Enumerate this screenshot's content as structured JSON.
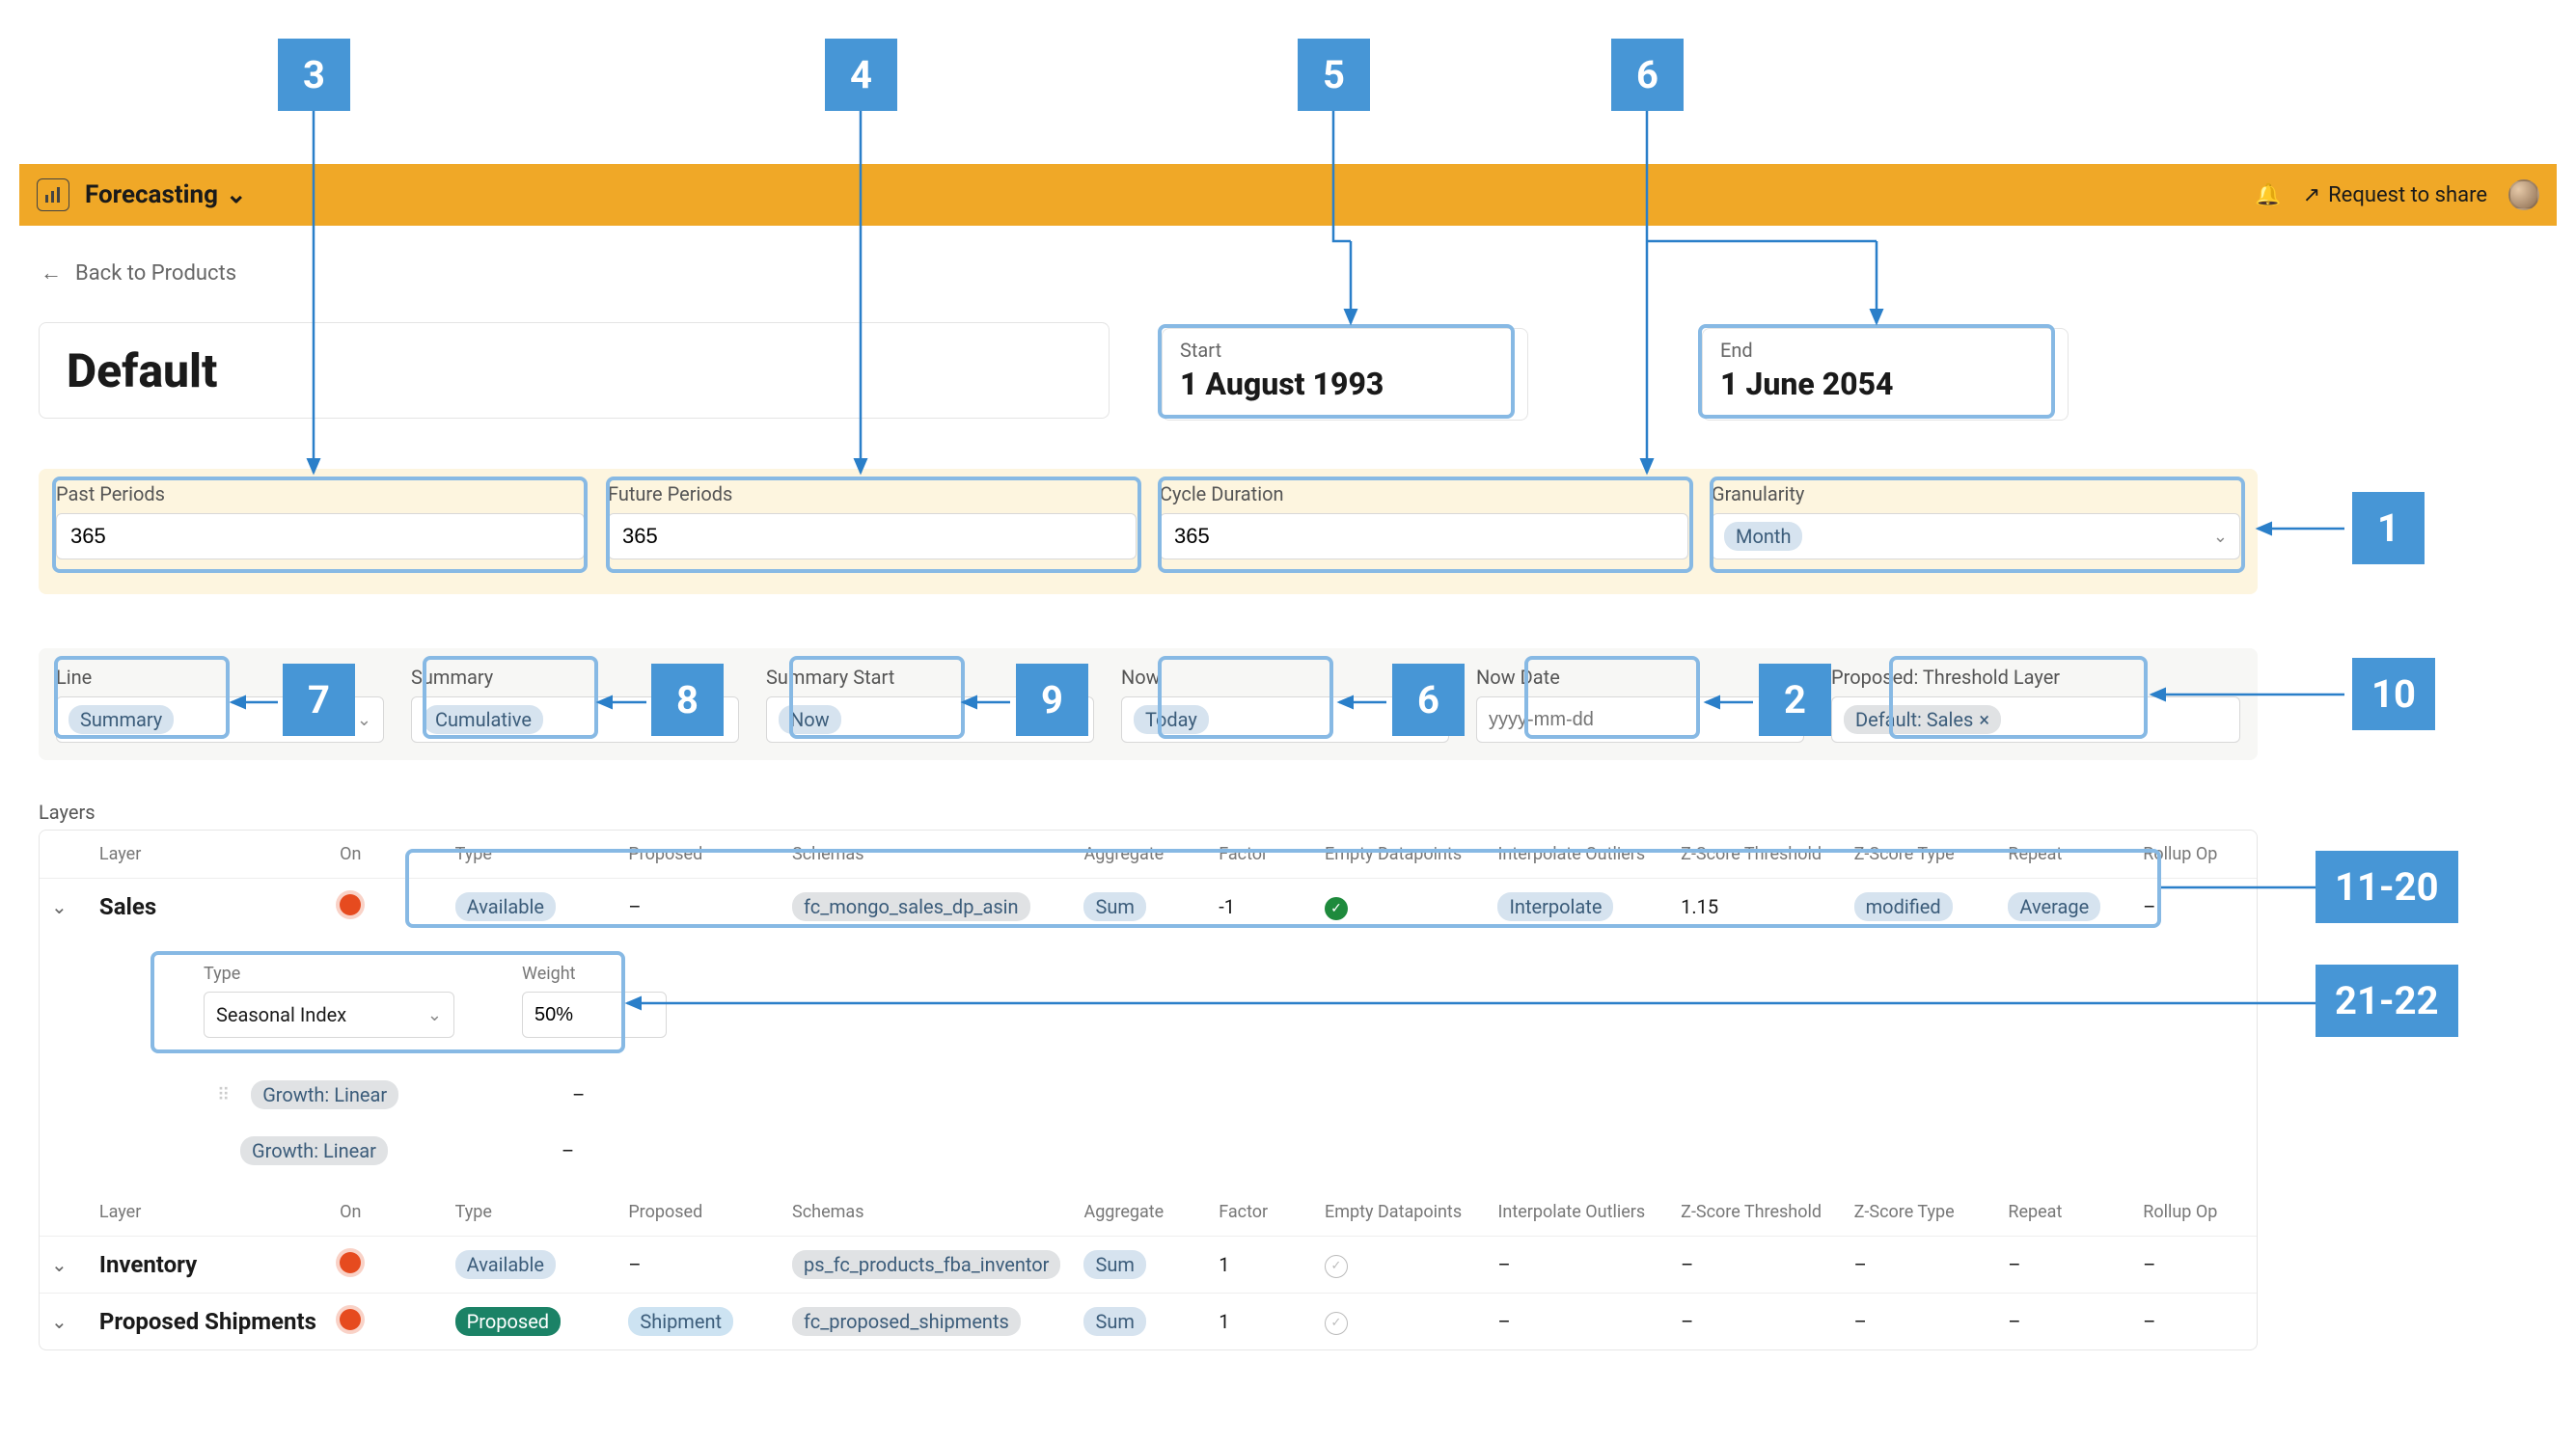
{
  "annotations": {
    "n1": "1",
    "n2": "2",
    "n3": "3",
    "n4": "4",
    "n5": "5",
    "n6": "6",
    "n7": "7",
    "n8": "8",
    "n9": "9",
    "n10": "10",
    "n11_20": "11-20",
    "n21_22": "21-22",
    "n6b": "6"
  },
  "header": {
    "title": "Forecasting",
    "share": "Request to share"
  },
  "back": "Back to Products",
  "page_title": "Default",
  "dates": {
    "start_lbl": "Start",
    "start_val": "1 August 1993",
    "end_lbl": "End",
    "end_val": "1 June 2054"
  },
  "periods": {
    "past_lbl": "Past Periods",
    "past_val": "365",
    "future_lbl": "Future Periods",
    "future_val": "365",
    "cycle_lbl": "Cycle Duration",
    "cycle_val": "365",
    "gran_lbl": "Granularity",
    "gran_val": "Month"
  },
  "controls": {
    "line_lbl": "Line",
    "line_val": "Summary",
    "summary_lbl": "Summary",
    "summary_val": "Cumulative",
    "sstart_lbl": "Summary Start",
    "sstart_val": "Now",
    "now_lbl": "Now",
    "now_val": "Today",
    "nowdate_lbl": "Now Date",
    "nowdate_ph": "yyyy-mm-dd",
    "thresh_lbl": "Proposed: Threshold Layer",
    "thresh_val": "Default: Sales"
  },
  "layers_lbl": "Layers",
  "cols": {
    "layer": "Layer",
    "on": "On",
    "type": "Type",
    "proposed": "Proposed",
    "schemas": "Schemas",
    "aggregate": "Aggregate",
    "factor": "Factor",
    "empty": "Empty Datapoints",
    "interp": "Interpolate Outliers",
    "zthresh": "Z-Score Threshold",
    "ztype": "Z-Score Type",
    "repeat": "Repeat",
    "rollup": "Rollup Op"
  },
  "rows": {
    "sales": {
      "name": "Sales",
      "type": "Available",
      "proposed": "–",
      "schema": "fc_mongo_sales_dp_asin",
      "agg": "Sum",
      "factor": "-1",
      "interp": "Interpolate",
      "zthresh": "1.15",
      "ztype": "modified",
      "repeat": "Average",
      "rollup": "–"
    },
    "inv": {
      "name": "Inventory",
      "type": "Available",
      "proposed": "–",
      "schema": "ps_fc_products_fba_inventor",
      "agg": "Sum",
      "factor": "1",
      "interp": "–",
      "zthresh": "–",
      "ztype": "–",
      "repeat": "–",
      "rollup": "–"
    },
    "ship": {
      "name": "Proposed Shipments",
      "type": "Proposed",
      "proposed": "Shipment",
      "schema": "fc_proposed_shipments",
      "agg": "Sum",
      "factor": "1",
      "interp": "–",
      "zthresh": "–",
      "ztype": "–",
      "repeat": "–",
      "rollup": "–"
    }
  },
  "sub": {
    "type_lbl": "Type",
    "weight_lbl": "Weight",
    "r1_type": "Seasonal Index",
    "r1_weight": "50%",
    "r2_type": "Growth: Linear",
    "r2_weight": "–",
    "r3_type": "Growth: Linear",
    "r3_weight": "–"
  }
}
